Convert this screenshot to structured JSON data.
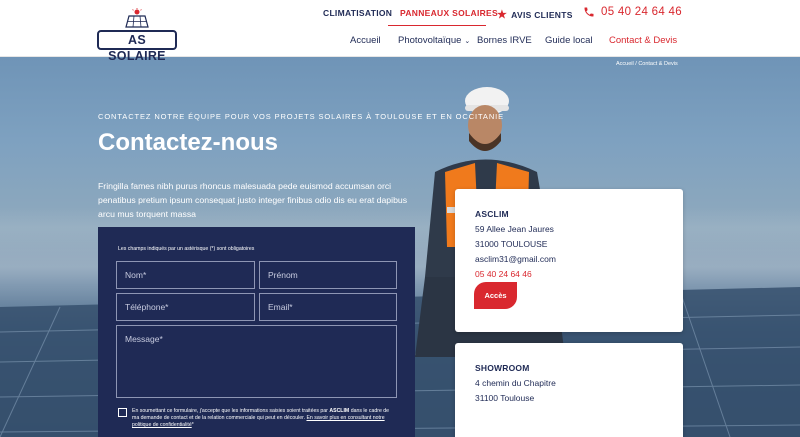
{
  "logo": {
    "text": "AS SOLAIRE"
  },
  "topnav": {
    "climatisation": "CLIMATISATION",
    "panneaux": "PANNEAUX SOLAIRES",
    "avis": "AVIS CLIENTS",
    "phone": "05 40 24 64 46"
  },
  "mainnav": {
    "accueil": "Accueil",
    "photovoltaique": "Photovoltaïque",
    "bornes": "Bornes IRVE",
    "guide": "Guide local",
    "contact": "Contact & Devis"
  },
  "breadcrumb": {
    "text": "Accueil / Contact & Devis"
  },
  "hero": {
    "subtitle": "CONTACTEZ NOTRE ÉQUIPE POUR VOS PROJETS SOLAIRES À TOULOUSE ET EN OCCITANIE",
    "title": "Contactez-nous",
    "description": "Fringilla fames nibh purus rhoncus malesuada pede euismod accumsan orci penatibus pretium ipsum consequat justo integer finibus odio dis eu erat dapibus arcu mus torquent massa"
  },
  "form": {
    "note": "Les champs indiqués par un astérisque (*) sont obligatoires",
    "nom_placeholder": "Nom*",
    "prenom_placeholder": "Prénom",
    "tel_placeholder": "Téléphone*",
    "email_placeholder": "Email*",
    "message_placeholder": "Message*",
    "consent_prefix": "En soumettant ce formulaire, j'accepte que les informations saisies soient traitées par ",
    "consent_company": "ASCLIM",
    "consent_middle": " dans le cadre de ma demande de contact et de la relation commerciale qui peut en découler. ",
    "consent_link": "En savoir plus en consultant notre politique de confidentialité",
    "consent_suffix": "*"
  },
  "card1": {
    "title": "ASCLIM",
    "address1": "59 Allee Jean Jaures",
    "address2": "31000 TOULOUSE",
    "email": "asclim31@gmail.com",
    "phone": "05 40 24 64 46",
    "button": "Accès"
  },
  "card2": {
    "title": "SHOWROOM",
    "address1": "4 chemin du Chapitre",
    "address2": "31100 Toulouse"
  },
  "colors": {
    "navy": "#1f2a55",
    "red": "#d9282f"
  },
  "icons": {
    "star": "★",
    "chevron": "⌄"
  }
}
